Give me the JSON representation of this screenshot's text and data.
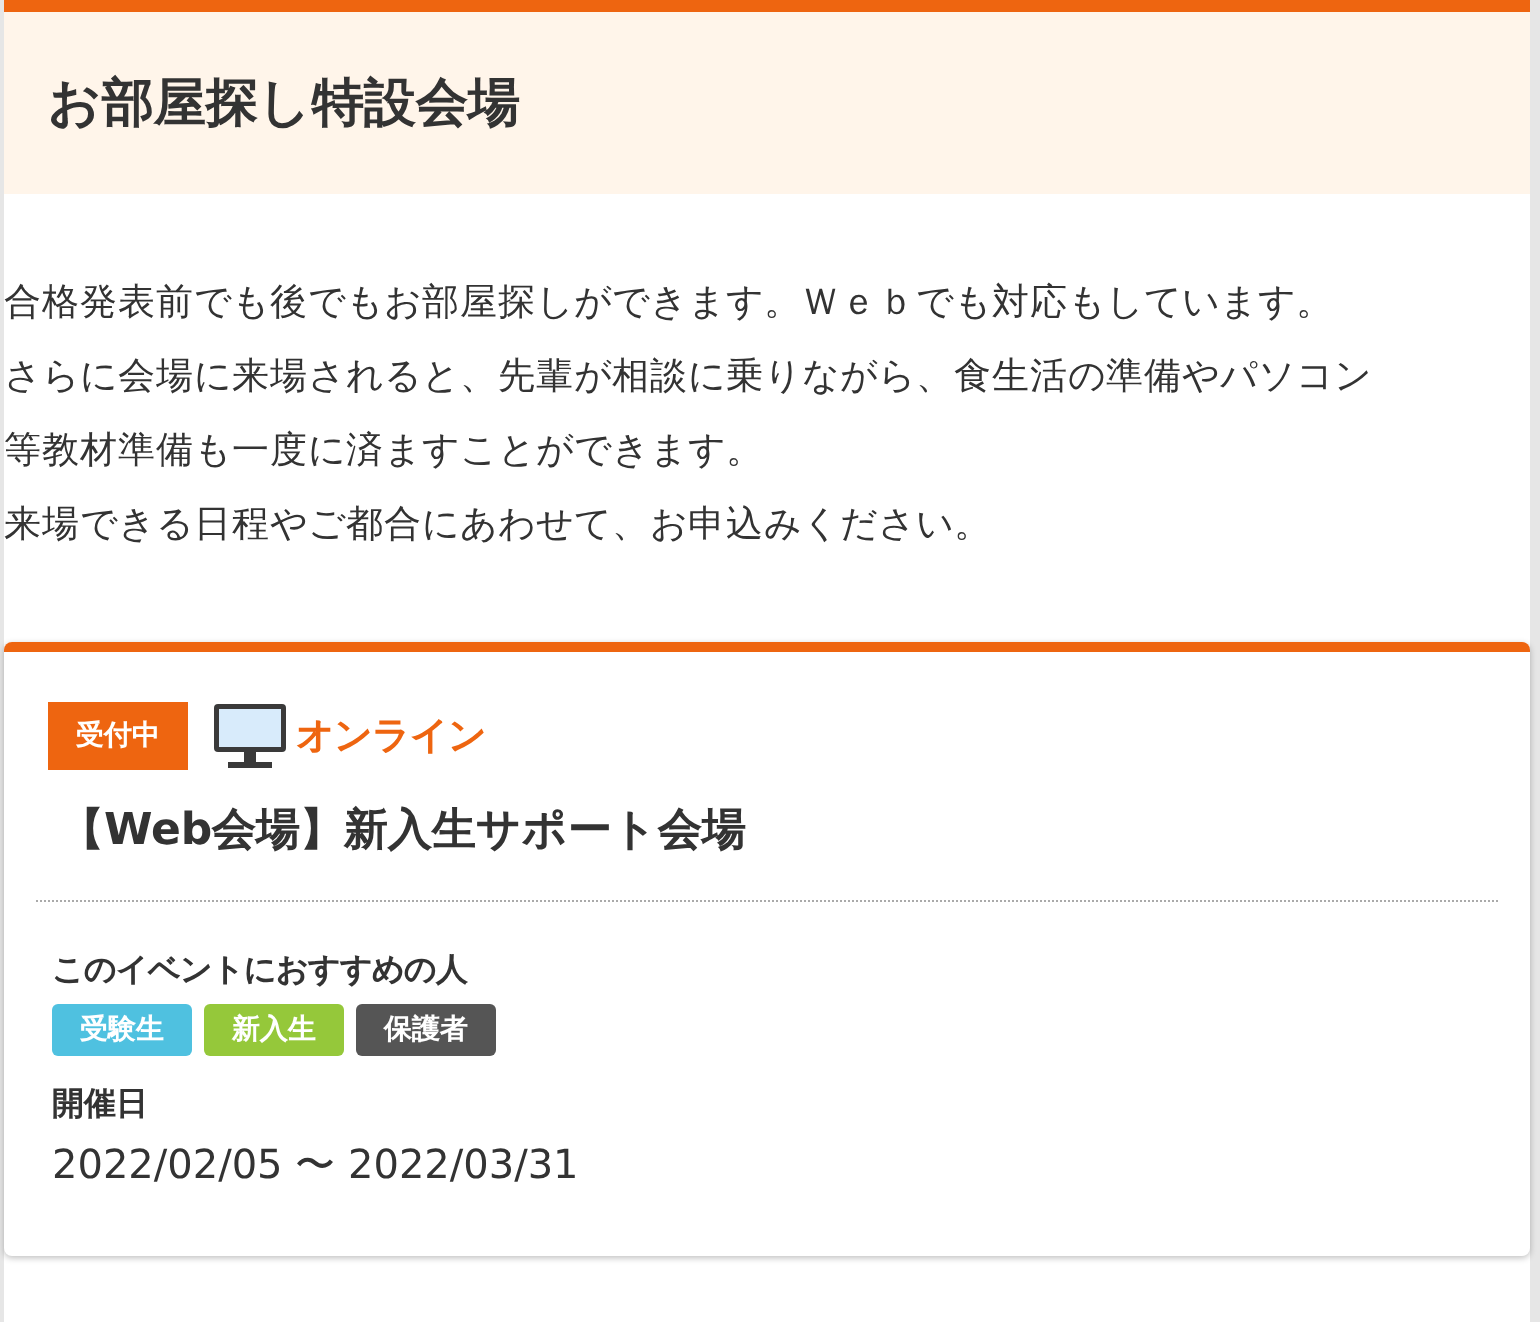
{
  "header": {
    "title": "お部屋探し特設会場"
  },
  "intro": {
    "lines": [
      "合格発表前でも後でもお部屋探しができます。Ｗｅｂでも対応もしています。",
      "さらに会場に来場されると、先輩が相談に乗りながら、食生活の準備やパソコン",
      "等教材準備も一度に済ますことができます。",
      "来場できる日程やご都合にあわせて、お申込みください。"
    ]
  },
  "event": {
    "status": "受付中",
    "format": {
      "kind": "online",
      "label": "オンライン"
    },
    "title": "【Web会場】新入生サポート会場",
    "audience_label": "このイベントにおすすめの人",
    "tags": [
      {
        "label": "受験生",
        "color": "#4fc1e0"
      },
      {
        "label": "新入生",
        "color": "#95c83a"
      },
      {
        "label": "保護者",
        "color": "#555555"
      }
    ],
    "date_label": "開催日",
    "dates": "2022/02/05 〜 2022/03/31"
  }
}
